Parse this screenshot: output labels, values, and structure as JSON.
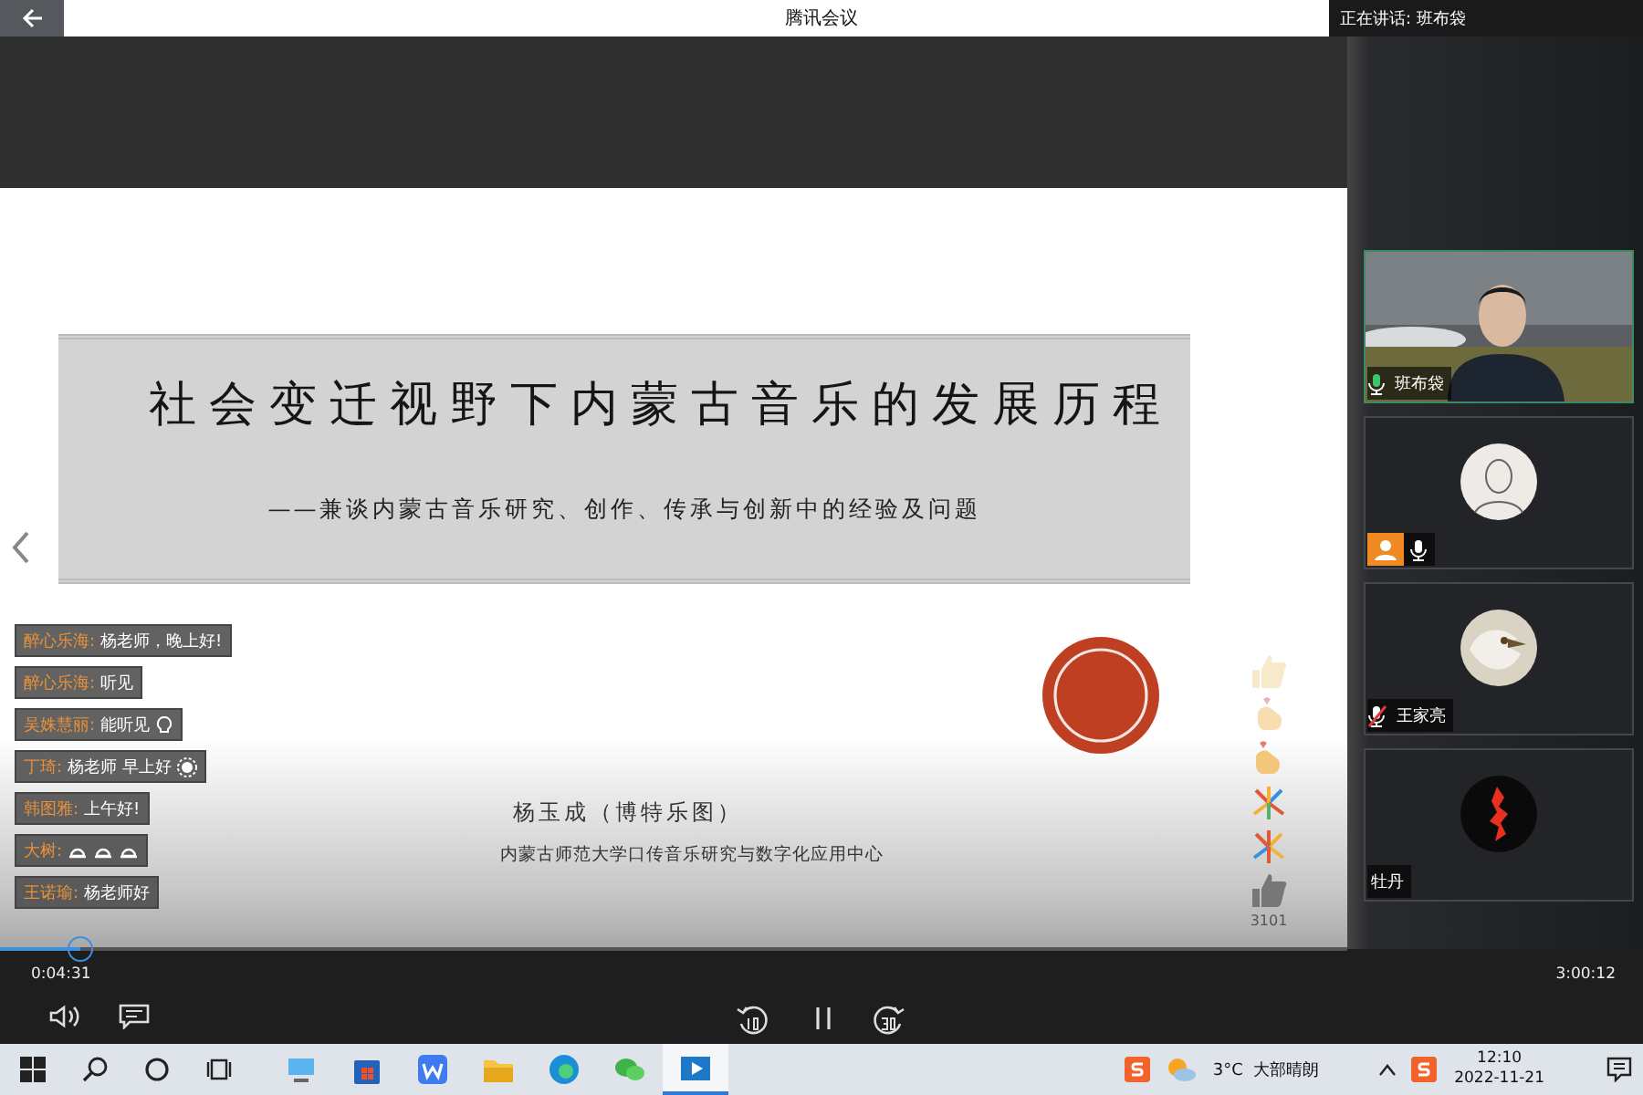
{
  "window": {
    "title": "腾讯会议",
    "speaking": "正在讲话: 班布袋"
  },
  "slide": {
    "title": "社会变迁视野下内蒙古音乐的发展历程",
    "subtitle": "——兼谈内蒙古音乐研究、创作、传承与创新中的经验及问题",
    "author": "杨玉成（博特乐图）",
    "affiliation": "内蒙古师范大学口传音乐研究与数字化应用中心"
  },
  "chat": [
    {
      "user": "醉心乐海:",
      "text": "杨老师，晚上好!"
    },
    {
      "user": "醉心乐海:",
      "text": "听见"
    },
    {
      "user": "吴姝慧丽:",
      "text": "能听见",
      "stickers": [
        {
          "kind": "bulb"
        }
      ]
    },
    {
      "user": "丁琦:",
      "text": "杨老师 早上好",
      "stickers": [
        {
          "kind": "sun"
        }
      ]
    },
    {
      "user": "韩图雅:",
      "text": "上午好!"
    },
    {
      "user": "大树:",
      "stickers": [
        {
          "kind": "bun"
        },
        {
          "kind": "bun"
        },
        {
          "kind": "bun"
        }
      ]
    },
    {
      "user": "王诺瑜:",
      "text": "杨老师好"
    }
  ],
  "likes": {
    "count": "3101"
  },
  "player": {
    "elapsed": "0:04:31",
    "duration": "3:00:12",
    "level": 0.06,
    "playing": true
  },
  "participants": [
    {
      "name": "班布袋",
      "kind": "video",
      "muted": false,
      "speaking": true
    },
    {
      "kind": "avatar",
      "muted": false,
      "host": true,
      "speaking": false
    },
    {
      "name": "王家亮",
      "kind": "avatar",
      "muted": true,
      "speaking": false
    },
    {
      "name": "牡丹",
      "kind": "avatar",
      "speaking": false
    }
  ],
  "taskbar": {
    "apps": [
      {
        "selected": false
      },
      {
        "selected": false
      },
      {
        "selected": false
      },
      {
        "selected": false
      },
      {
        "selected": false
      },
      {
        "selected": false
      },
      {
        "selected": true
      }
    ],
    "weather": "3°C  大部晴朗",
    "time": "12:10",
    "date": "2022-11-21"
  }
}
